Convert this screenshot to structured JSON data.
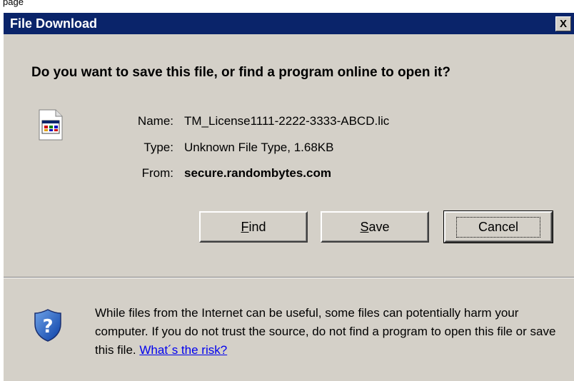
{
  "page": {
    "top_text": "page"
  },
  "dialog": {
    "title": "File Download",
    "close_label": "X",
    "question": "Do you want to save this file, or find a program online to open it?"
  },
  "file": {
    "name_label": "Name:",
    "name_value": "TM_License1111-2222-3333-ABCD.lic",
    "type_label": "Type:",
    "type_value": "Unknown File Type, 1.68KB",
    "from_label": "From:",
    "from_value": "secure.randombytes.com",
    "icon": "file-icon"
  },
  "buttons": {
    "find_accel": "F",
    "find_rest": "ind",
    "save_accel": "S",
    "save_rest": "ave",
    "cancel_label": "Cancel"
  },
  "warning": {
    "icon": "shield-question-icon",
    "text": "While files from the Internet can be useful, some files can potentially harm your computer. If you do not trust the source, do not find a program to open this file or save this file. ",
    "link": "What´s the risk?"
  },
  "colors": {
    "titlebar": "#0a246a",
    "dialog_bg": "#d4d0c8",
    "link": "#0000ee"
  }
}
